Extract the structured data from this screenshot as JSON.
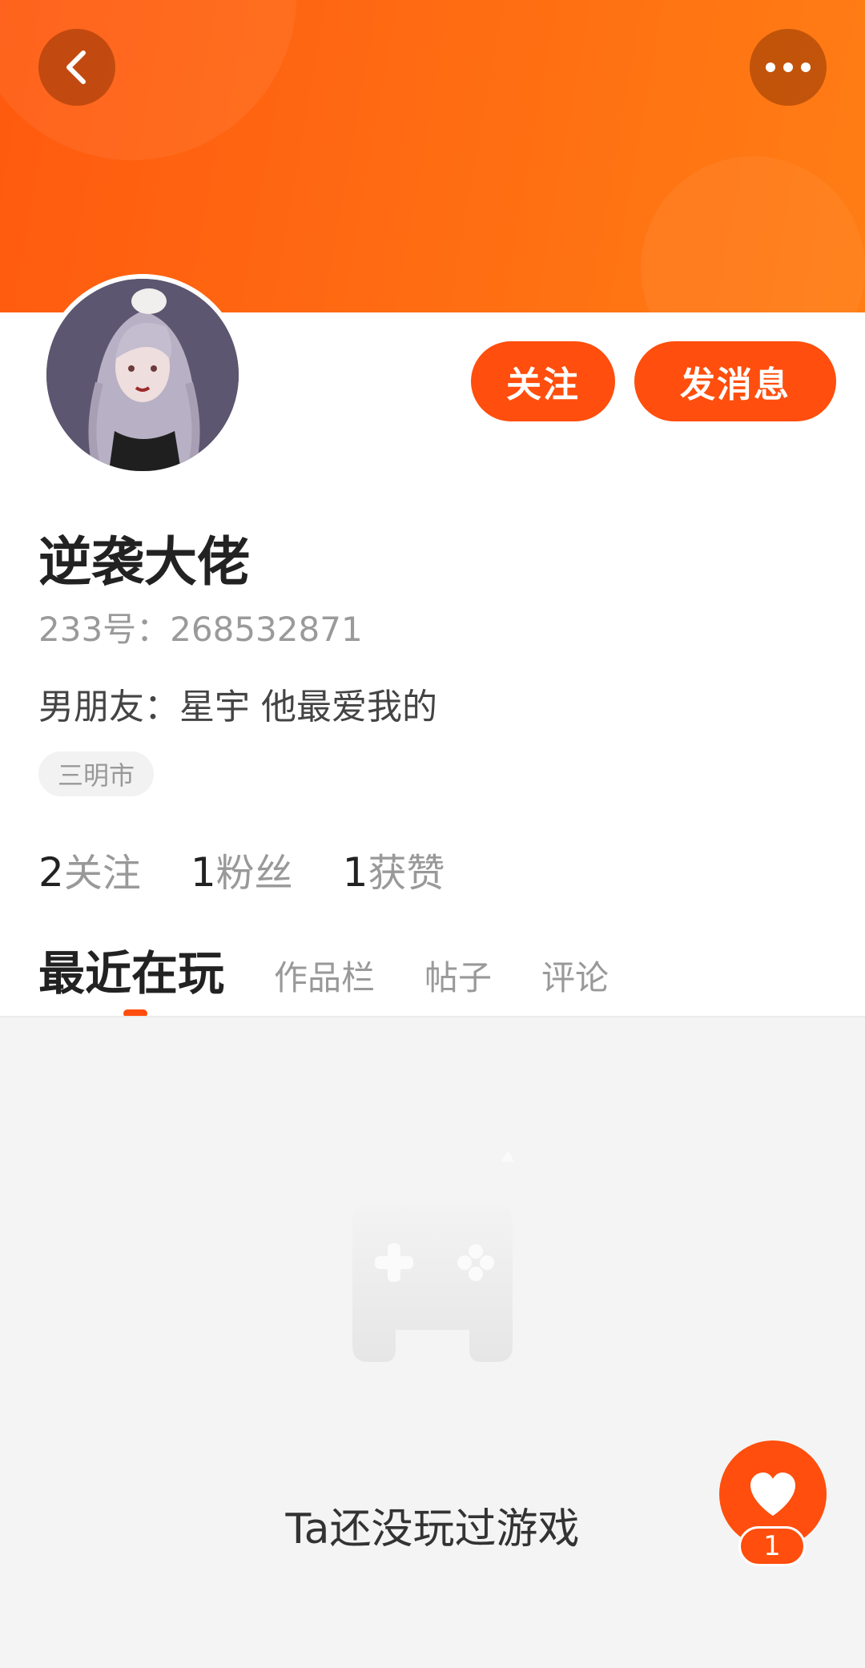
{
  "header": {
    "back_icon": "chevron-left-icon",
    "more_icon": "more-horizontal-icon"
  },
  "actions": {
    "follow_label": "关注",
    "message_label": "发消息"
  },
  "profile": {
    "username": "逆袭大佬",
    "id_text": "233号：268532871",
    "bio": "男朋友：星宇   他最爱我的",
    "location": "三明市"
  },
  "stats": {
    "following_count": "2",
    "following_label": "关注",
    "fans_count": "1",
    "fans_label": "粉丝",
    "likes_count": "1",
    "likes_label": "获赞"
  },
  "tabs": [
    {
      "label": "最近在玩",
      "active": true
    },
    {
      "label": "作品栏",
      "active": false
    },
    {
      "label": "帖子",
      "active": false
    },
    {
      "label": "评论",
      "active": false
    }
  ],
  "empty_state": {
    "icon": "gamepad-icon",
    "text": "Ta还没玩过游戏"
  },
  "like_button": {
    "icon": "heart-icon",
    "count": "1"
  },
  "colors": {
    "accent": "#ff4e0d",
    "banner_start": "#ff5a0f",
    "banner_end": "#ff7d14",
    "content_bg": "#f4f4f4"
  }
}
